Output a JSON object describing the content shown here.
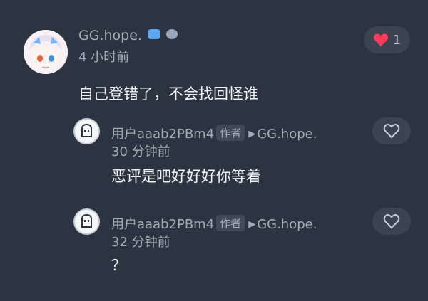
{
  "comment": {
    "username": "GG.hope.",
    "time": "4 小时前",
    "content": "自己登错了，不会找回怪谁",
    "like_count": "1",
    "badges": [
      "game-badge-icon",
      "level-badge-icon"
    ],
    "liked_color": "#ff3b5c"
  },
  "replies": [
    {
      "username": "用户aaab2PBm4",
      "author_tag": "作者",
      "reply_to": "GG.hope.",
      "time": "30 分钟前",
      "content": "恶评是吧好好好你等着"
    },
    {
      "username": "用户aaab2PBm4",
      "author_tag": "作者",
      "reply_to": "GG.hope.",
      "time": "32 分钟前",
      "content": "？"
    }
  ]
}
